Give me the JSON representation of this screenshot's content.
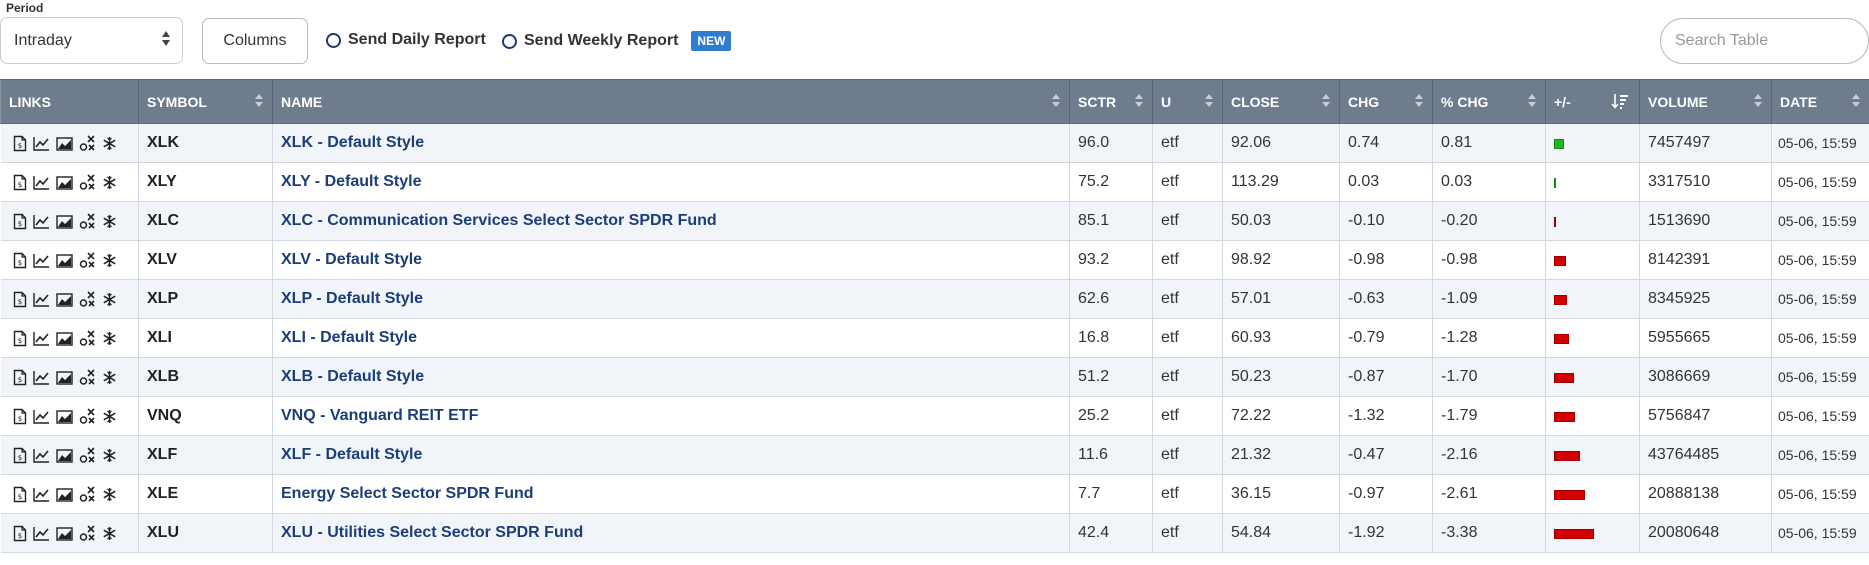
{
  "controls": {
    "period_label": "Period",
    "period_value": "Intraday",
    "columns_label": "Columns",
    "daily_report_label": "Send Daily Report",
    "weekly_report_label": "Send Weekly Report",
    "new_badge": "NEW",
    "search_placeholder": "Search Table"
  },
  "columns": {
    "links": "LINKS",
    "symbol": "SYMBOL",
    "name": "NAME",
    "sctr": "SCTR",
    "u": "U",
    "close": "CLOSE",
    "chg": "CHG",
    "pct_chg": "% CHG",
    "plus_minus": "+/-",
    "volume": "VOLUME",
    "date": "DATE"
  },
  "colors": {
    "positive": "#22b422",
    "negative": "#d40000",
    "header": "#6f7c8e",
    "link": "#1b3e7a"
  },
  "link_icons": [
    "document-icon",
    "line-chart-icon",
    "area-chart-icon",
    "point-figure-icon",
    "seasonality-icon"
  ],
  "bar_scale_max_pct": 3.38,
  "rows": [
    {
      "symbol": "XLK",
      "name": "XLK - Default Style",
      "sctr": "96.0",
      "u": "etf",
      "close": "92.06",
      "chg": "0.74",
      "pct_chg": "0.81",
      "volume": "7457497",
      "date": "05-06, 15:59",
      "pct": 0.81
    },
    {
      "symbol": "XLY",
      "name": "XLY - Default Style",
      "sctr": "75.2",
      "u": "etf",
      "close": "113.29",
      "chg": "0.03",
      "pct_chg": "0.03",
      "volume": "3317510",
      "date": "05-06, 15:59",
      "pct": 0.03
    },
    {
      "symbol": "XLC",
      "name": "XLC - Communication Services Select Sector SPDR Fund",
      "sctr": "85.1",
      "u": "etf",
      "close": "50.03",
      "chg": "-0.10",
      "pct_chg": "-0.20",
      "volume": "1513690",
      "date": "05-06, 15:59",
      "pct": -0.2
    },
    {
      "symbol": "XLV",
      "name": "XLV - Default Style",
      "sctr": "93.2",
      "u": "etf",
      "close": "98.92",
      "chg": "-0.98",
      "pct_chg": "-0.98",
      "volume": "8142391",
      "date": "05-06, 15:59",
      "pct": -0.98
    },
    {
      "symbol": "XLP",
      "name": "XLP - Default Style",
      "sctr": "62.6",
      "u": "etf",
      "close": "57.01",
      "chg": "-0.63",
      "pct_chg": "-1.09",
      "volume": "8345925",
      "date": "05-06, 15:59",
      "pct": -1.09
    },
    {
      "symbol": "XLI",
      "name": "XLI - Default Style",
      "sctr": "16.8",
      "u": "etf",
      "close": "60.93",
      "chg": "-0.79",
      "pct_chg": "-1.28",
      "volume": "5955665",
      "date": "05-06, 15:59",
      "pct": -1.28
    },
    {
      "symbol": "XLB",
      "name": "XLB - Default Style",
      "sctr": "51.2",
      "u": "etf",
      "close": "50.23",
      "chg": "-0.87",
      "pct_chg": "-1.70",
      "volume": "3086669",
      "date": "05-06, 15:59",
      "pct": -1.7
    },
    {
      "symbol": "VNQ",
      "name": "VNQ - Vanguard REIT ETF",
      "sctr": "25.2",
      "u": "etf",
      "close": "72.22",
      "chg": "-1.32",
      "pct_chg": "-1.79",
      "volume": "5756847",
      "date": "05-06, 15:59",
      "pct": -1.79
    },
    {
      "symbol": "XLF",
      "name": "XLF - Default Style",
      "sctr": "11.6",
      "u": "etf",
      "close": "21.32",
      "chg": "-0.47",
      "pct_chg": "-2.16",
      "volume": "43764485",
      "date": "05-06, 15:59",
      "pct": -2.16
    },
    {
      "symbol": "XLE",
      "name": "Energy Select Sector SPDR Fund",
      "sctr": "7.7",
      "u": "etf",
      "close": "36.15",
      "chg": "-0.97",
      "pct_chg": "-2.61",
      "volume": "20888138",
      "date": "05-06, 15:59",
      "pct": -2.61
    },
    {
      "symbol": "XLU",
      "name": "XLU - Utilities Select Sector SPDR Fund",
      "sctr": "42.4",
      "u": "etf",
      "close": "54.84",
      "chg": "-1.92",
      "pct_chg": "-3.38",
      "volume": "20080648",
      "date": "05-06, 15:59",
      "pct": -3.38
    }
  ]
}
